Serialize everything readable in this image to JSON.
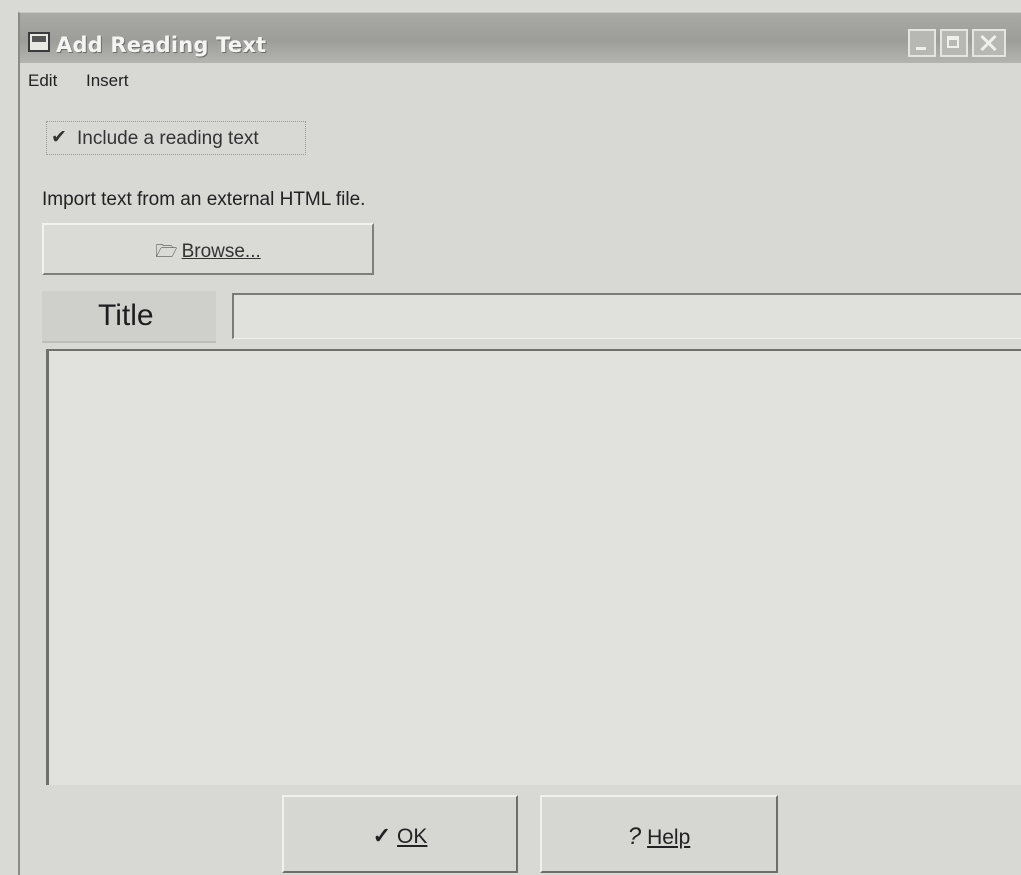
{
  "window": {
    "title": "Add Reading Text",
    "controls": {
      "minimize_icon": "minimize-icon",
      "maximize_icon": "maximize-icon",
      "close_icon": "close-icon"
    }
  },
  "menubar": {
    "items": [
      {
        "label": "Edit"
      },
      {
        "label": "Insert"
      }
    ]
  },
  "form": {
    "include_checkbox": {
      "label": "Include a reading text",
      "checked": true
    },
    "import_label": "Import text from an external HTML file.",
    "browse_button": {
      "label": "Browse...",
      "icon": "folder-open-icon"
    },
    "title_label": "Title",
    "title_value": "",
    "text_area_value": ""
  },
  "buttons": {
    "ok": {
      "label": "OK",
      "icon": "checkmark-icon"
    },
    "help": {
      "label": "Help",
      "icon": "question-mark-icon"
    }
  }
}
